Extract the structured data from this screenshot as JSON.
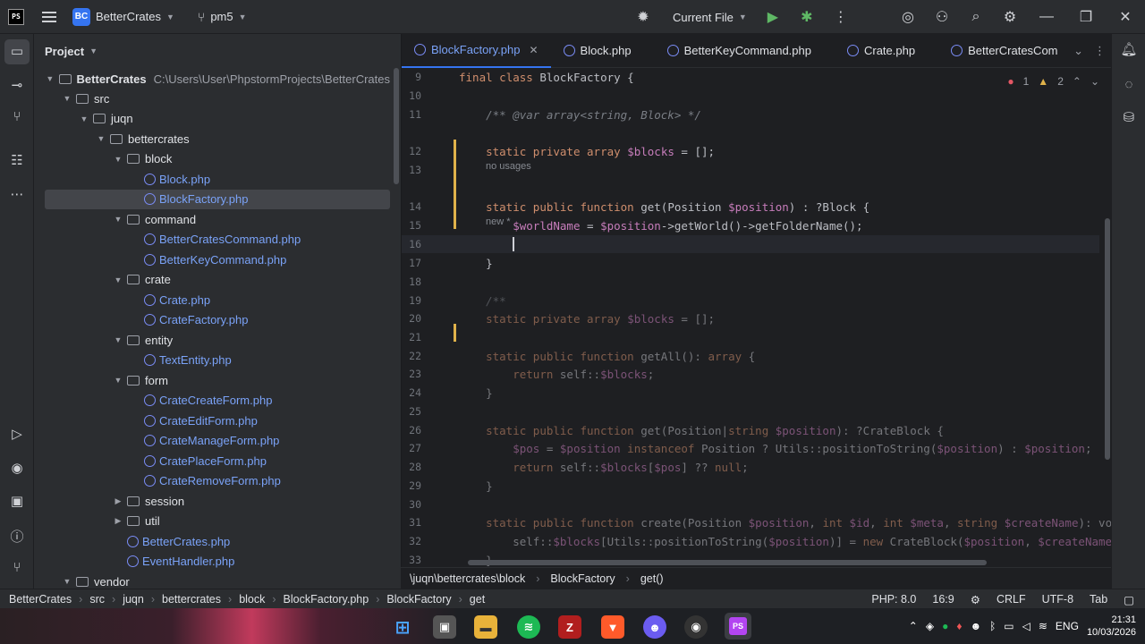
{
  "titlebar": {
    "project_badge": "BC",
    "project_name": "BetterCrates",
    "branch": "pm5",
    "run_config": "Current File"
  },
  "project_panel": {
    "title": "Project",
    "root_name": "BetterCrates",
    "root_path": "C:\\Users\\User\\PhpstormProjects\\BetterCrates",
    "items": [
      {
        "label": "src",
        "type": "folder",
        "depth": 1,
        "expanded": true
      },
      {
        "label": "juqn",
        "type": "folder",
        "depth": 2,
        "expanded": true
      },
      {
        "label": "bettercrates",
        "type": "folder",
        "depth": 3,
        "expanded": true
      },
      {
        "label": "block",
        "type": "folder",
        "depth": 4,
        "expanded": true
      },
      {
        "label": "Block.php",
        "type": "file",
        "depth": 5
      },
      {
        "label": "BlockFactory.php",
        "type": "file",
        "depth": 5,
        "selected": true
      },
      {
        "label": "command",
        "type": "folder",
        "depth": 4,
        "expanded": true
      },
      {
        "label": "BetterCratesCommand.php",
        "type": "file",
        "depth": 5
      },
      {
        "label": "BetterKeyCommand.php",
        "type": "file",
        "depth": 5
      },
      {
        "label": "crate",
        "type": "folder",
        "depth": 4,
        "expanded": true
      },
      {
        "label": "Crate.php",
        "type": "file",
        "depth": 5
      },
      {
        "label": "CrateFactory.php",
        "type": "file",
        "depth": 5
      },
      {
        "label": "entity",
        "type": "folder",
        "depth": 4,
        "expanded": true
      },
      {
        "label": "TextEntity.php",
        "type": "file",
        "depth": 5
      },
      {
        "label": "form",
        "type": "folder",
        "depth": 4,
        "expanded": true
      },
      {
        "label": "CrateCreateForm.php",
        "type": "file",
        "depth": 5
      },
      {
        "label": "CrateEditForm.php",
        "type": "file",
        "depth": 5
      },
      {
        "label": "CrateManageForm.php",
        "type": "file",
        "depth": 5
      },
      {
        "label": "CratePlaceForm.php",
        "type": "file",
        "depth": 5
      },
      {
        "label": "CrateRemoveForm.php",
        "type": "file",
        "depth": 5
      },
      {
        "label": "session",
        "type": "folder",
        "depth": 4,
        "expanded": false
      },
      {
        "label": "util",
        "type": "folder",
        "depth": 4,
        "expanded": false
      },
      {
        "label": "BetterCrates.php",
        "type": "file",
        "depth": 4
      },
      {
        "label": "EventHandler.php",
        "type": "file",
        "depth": 4
      },
      {
        "label": "vendor",
        "type": "folder",
        "depth": 1,
        "expanded": true
      }
    ]
  },
  "editor": {
    "tabs": [
      {
        "label": "BlockFactory.php",
        "active": true
      },
      {
        "label": "Block.php"
      },
      {
        "label": "BetterKeyCommand.php"
      },
      {
        "label": "Crate.php"
      },
      {
        "label": "BetterCratesCom"
      }
    ],
    "inspections": {
      "errors": "1",
      "warnings": "2"
    },
    "hints": {
      "no_usages": "no usages",
      "new": "new *"
    },
    "lines": [
      {
        "n": "9",
        "text": "final class BlockFactory {"
      },
      {
        "n": "10",
        "text": ""
      },
      {
        "n": "11",
        "text": "    /** @var array<string, Block> */"
      },
      {
        "n": "12",
        "text": "    static private array $blocks = [];"
      },
      {
        "n": "13",
        "text": ""
      },
      {
        "n": "14",
        "text": "    static public function get(Position $position) : ?Block {"
      },
      {
        "n": "15",
        "text": "        $worldName = $position->getWorld()->getFolderName();"
      },
      {
        "n": "16",
        "text": "        "
      },
      {
        "n": "17",
        "text": "    }"
      },
      {
        "n": "18",
        "text": ""
      },
      {
        "n": "19",
        "text": "    /**"
      },
      {
        "n": "20",
        "text": "    static private array $blocks = [];"
      },
      {
        "n": "21",
        "text": ""
      },
      {
        "n": "22",
        "text": "    static public function getAll(): array {"
      },
      {
        "n": "23",
        "text": "        return self::$blocks;"
      },
      {
        "n": "24",
        "text": "    }"
      },
      {
        "n": "25",
        "text": ""
      },
      {
        "n": "26",
        "text": "    static public function get(Position|string $position): ?CrateBlock {"
      },
      {
        "n": "27",
        "text": "        $pos = $position instanceof Position ? Utils::positionToString($position) : $position;"
      },
      {
        "n": "28",
        "text": "        return self::$blocks[$pos] ?? null;"
      },
      {
        "n": "29",
        "text": "    }"
      },
      {
        "n": "30",
        "text": ""
      },
      {
        "n": "31",
        "text": "    static public function create(Position $position, int $id, int $meta, string $createName): voi"
      },
      {
        "n": "32",
        "text": "        self::$blocks[Utils::positionToString($position)] = new CrateBlock($position, $createName"
      },
      {
        "n": "33",
        "text": "    }"
      }
    ]
  },
  "editor_breadcrumb": [
    "\\juqn\\bettercrates\\block",
    "BlockFactory",
    "get()"
  ],
  "statusbar": {
    "crumbs": [
      "BetterCrates",
      "src",
      "juqn",
      "bettercrates",
      "block",
      "BlockFactory.php",
      "BlockFactory",
      "get"
    ],
    "php_version": "PHP: 8.0",
    "position": "16:9",
    "line_ending": "CRLF",
    "encoding": "UTF-8",
    "indent": "Tab"
  },
  "taskbar": {
    "lang": "ENG",
    "time": "21:31",
    "date": "10/03/2026"
  }
}
